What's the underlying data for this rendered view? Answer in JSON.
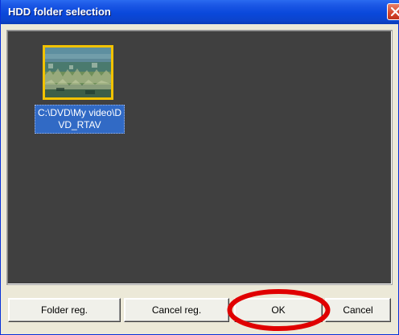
{
  "window": {
    "title": "HDD folder selection"
  },
  "folder_list": {
    "items": [
      {
        "label": "C:\\DVD\\My video\\DVD_RTAV",
        "thumbnail": "video-thumbnail",
        "selected": true
      }
    ]
  },
  "buttons": {
    "folder_reg": "Folder reg.",
    "cancel_reg": "Cancel reg.",
    "ok": "OK",
    "cancel": "Cancel"
  },
  "annotation": {
    "highlight_color": "#e00000",
    "highlight_target": "ok"
  },
  "colors": {
    "titlebar": "#0a48db",
    "view_background": "#404040",
    "selection": "#316ac5",
    "thumb_border": "#f2c200"
  },
  "icons": {
    "close": "close-icon"
  }
}
